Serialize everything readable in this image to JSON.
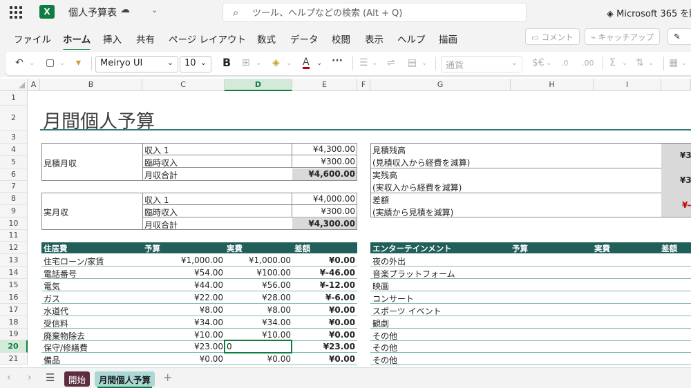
{
  "titlebar": {
    "doc_title": "個人予算表",
    "search_placeholder": "ツール、ヘルプなどの検索 (Alt + Q)",
    "ms365": "Microsoft 365 を購"
  },
  "menu": {
    "tabs": [
      "ファイル",
      "ホーム",
      "挿入",
      "共有",
      "ページ レイアウト",
      "数式",
      "データ",
      "校閲",
      "表示",
      "ヘルプ",
      "描画"
    ],
    "active": "ホーム",
    "comment": "コメント",
    "catchup": "キャッチアップ"
  },
  "ribbon": {
    "font_name": "Meiryo UI",
    "font_size": "10",
    "number_format": "通貨",
    "more": "···"
  },
  "columns": [
    "A",
    "B",
    "C",
    "D",
    "E",
    "F",
    "G",
    "H",
    "I"
  ],
  "selected_column": "D",
  "rows": [
    "1",
    "2",
    "3",
    "4",
    "5",
    "6",
    "7",
    "8",
    "9",
    "10",
    "11",
    "12",
    "13",
    "14",
    "15",
    "16",
    "17",
    "18",
    "19",
    "20",
    "21"
  ],
  "selected_row": "20",
  "sheet": {
    "title": "月間個人予算",
    "estimate": {
      "label": "見積月収",
      "rows": [
        {
          "label": "収入 1",
          "value": "¥4,300.00"
        },
        {
          "label": "臨時収入",
          "value": "¥300.00"
        },
        {
          "label": "月収合計",
          "value": "¥4,600.00"
        }
      ]
    },
    "actual": {
      "label": "実月収",
      "rows": [
        {
          "label": "収入 1",
          "value": "¥4,000.00"
        },
        {
          "label": "臨時収入",
          "value": "¥300.00"
        },
        {
          "label": "月収合計",
          "value": "¥4,300.00"
        }
      ]
    },
    "balance": [
      {
        "line1": "見積残高",
        "line2": "(見積収入から経費を減算)",
        "value": "¥3"
      },
      {
        "line1": "実残高",
        "line2": "(実収入から経費を減算)",
        "value": "¥3"
      },
      {
        "line1": "差額",
        "line2": "(実績から見積を減算)",
        "value": "¥-"
      }
    ],
    "housing": {
      "headers": [
        "住居費",
        "予算",
        "実費",
        "差額"
      ],
      "rows": [
        {
          "item": "住宅ローン/家賃",
          "budget": "¥1,000.00",
          "actual": "¥1,000.00",
          "diff": "¥0.00"
        },
        {
          "item": "電話番号",
          "budget": "¥54.00",
          "actual": "¥100.00",
          "diff": "¥-46.00"
        },
        {
          "item": "電気",
          "budget": "¥44.00",
          "actual": "¥56.00",
          "diff": "¥-12.00"
        },
        {
          "item": "ガス",
          "budget": "¥22.00",
          "actual": "¥28.00",
          "diff": "¥-6.00"
        },
        {
          "item": "水道代",
          "budget": "¥8.00",
          "actual": "¥8.00",
          "diff": "¥0.00"
        },
        {
          "item": "受信料",
          "budget": "¥34.00",
          "actual": "¥34.00",
          "diff": "¥0.00"
        },
        {
          "item": "廃棄物除去",
          "budget": "¥10.00",
          "actual": "¥10.00",
          "diff": "¥0.00"
        },
        {
          "item": "保守/修繕費",
          "budget": "¥23.00",
          "actual": "0",
          "diff": "¥23.00"
        },
        {
          "item": "備品",
          "budget": "¥0.00",
          "actual": "¥0.00",
          "diff": "¥0.00"
        }
      ]
    },
    "entertainment": {
      "headers": [
        "エンターテインメント",
        "予算",
        "実費",
        "差額"
      ],
      "rows": [
        "夜の外出",
        "音楽プラットフォーム",
        "映画",
        "コンサート",
        "スポーツ イベント",
        "観劇",
        "その他",
        "その他",
        "その他"
      ]
    }
  },
  "sheet_tabs": [
    "開始",
    "月間個人予算"
  ],
  "colors": {
    "accent": "#107c41",
    "header_fill": "#215f5b",
    "tab1": "#5c2d3f",
    "tab2": "#a9d8d6",
    "negative": "#c00000"
  }
}
